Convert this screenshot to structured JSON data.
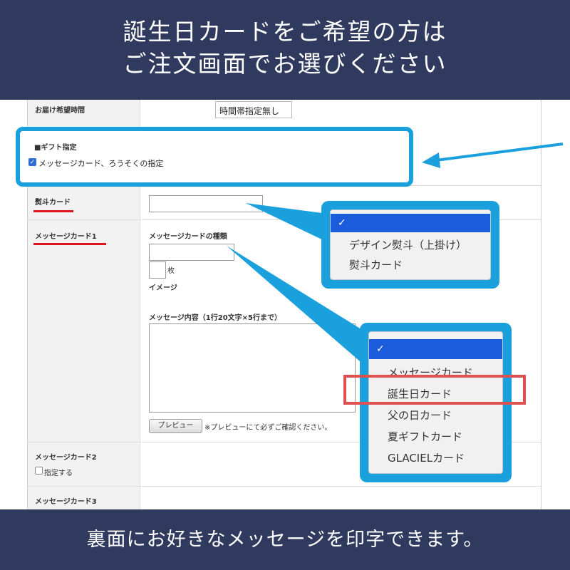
{
  "header": {
    "line1": "誕生日カードをご希望の方は",
    "line2": "ご注文画面でお選びください"
  },
  "footer": {
    "text": "裏面にお好きなメッセージを印字できます。"
  },
  "form": {
    "delivery_time": {
      "label": "お届け希望時間",
      "value": "時間帯指定無し"
    },
    "gift": {
      "heading": "■ギフト指定",
      "checkbox_label": "メッセージカード、ろうそくの指定",
      "checked": true
    },
    "noshi": {
      "label": "熨斗カード"
    },
    "message_card1": {
      "label": "メッセージカード1",
      "type_label": "メッセージカードの種類",
      "count_unit": "枚",
      "image_label": "イメージ",
      "content_label": "メッセージ内容（1行20文字×5行まで）",
      "preview_button": "プレビュー",
      "preview_note": "※プレビューにて必ずご確認ください。"
    },
    "message_card2": {
      "label": "メッセージカード2",
      "checkbox_label": "指定する"
    },
    "message_card3": {
      "label": "メッセージカード3"
    }
  },
  "noshi_dropdown": {
    "selected_mark": "✓",
    "options": [
      "デザイン熨斗（上掛け）",
      "熨斗カード"
    ]
  },
  "message_dropdown": {
    "selected_mark": "✓",
    "options": [
      "メッセージカード",
      "誕生日カード",
      "父の日カード",
      "夏ギフトカード",
      "GLACIELカード"
    ],
    "highlighted": "誕生日カード"
  },
  "colors": {
    "banner": "#2f3a5e",
    "callout": "#1aa0dc",
    "underline": "#e0141e",
    "highlight_box": "#e05050",
    "selected_option": "#1a5cdc"
  }
}
